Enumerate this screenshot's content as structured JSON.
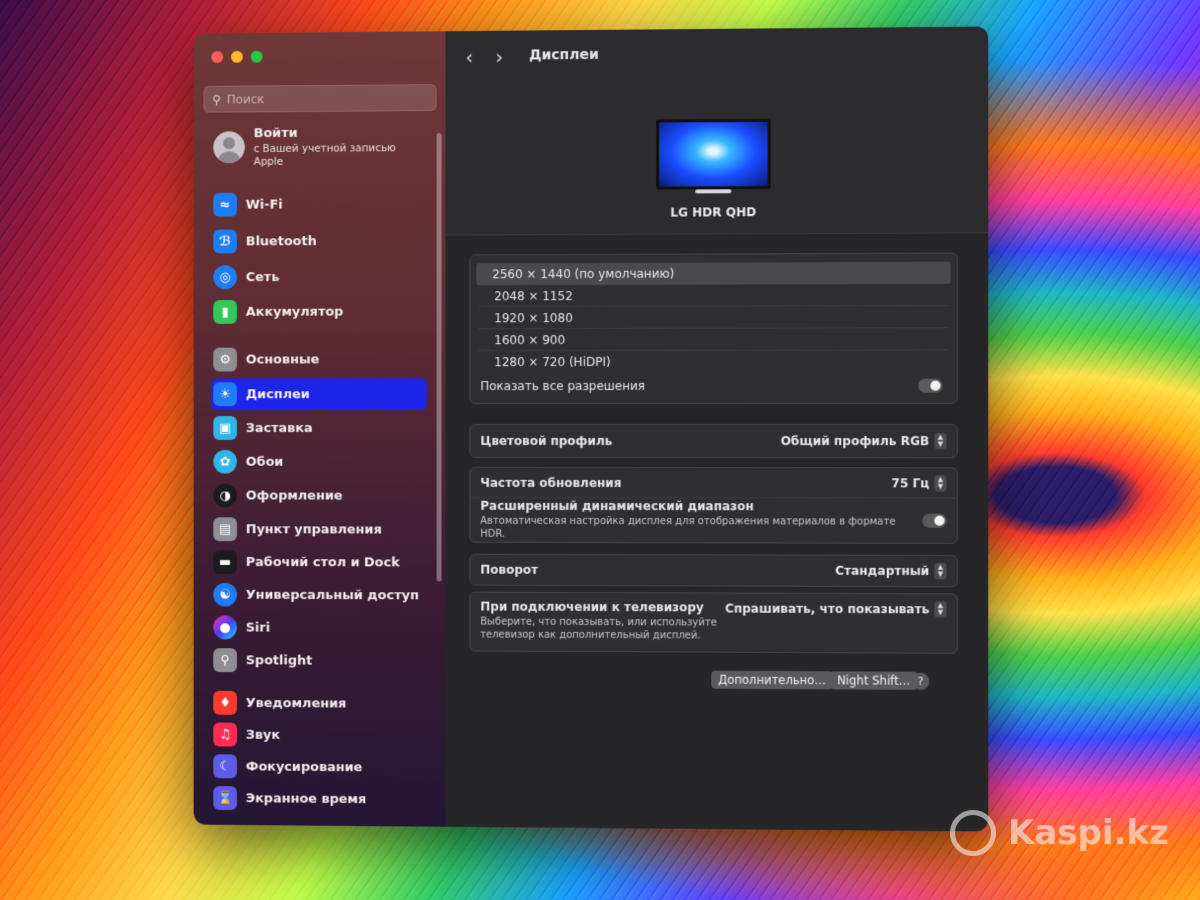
{
  "window": {
    "title": "Дисплеи"
  },
  "sidebar": {
    "search_placeholder": "Поиск",
    "account": {
      "title": "Войти",
      "subtitle": "с Вашей учетной записью Apple"
    },
    "items": [
      {
        "label": "Wi-Fi",
        "icon": "wifi-icon",
        "color": "#1e7cf5"
      },
      {
        "label": "Bluetooth",
        "icon": "bluetooth-icon",
        "color": "#1e7cf5"
      },
      {
        "label": "Сеть",
        "icon": "globe-icon",
        "color": "#1e7cf5"
      },
      {
        "label": "Аккумулятор",
        "icon": "battery-icon",
        "color": "#34c759"
      },
      {
        "label": "Основные",
        "icon": "gear-icon",
        "color": "#8e8e93"
      },
      {
        "label": "Дисплеи",
        "icon": "sun-icon",
        "color": "#1e7cf5",
        "selected": true
      },
      {
        "label": "Заставка",
        "icon": "screensaver-icon",
        "color": "#2fb5e8"
      },
      {
        "label": "Обои",
        "icon": "flower-icon",
        "color": "#2fb5e8"
      },
      {
        "label": "Оформление",
        "icon": "appearance-icon",
        "color": "#1c1c1e"
      },
      {
        "label": "Пункт управления",
        "icon": "control-center-icon",
        "color": "#8e8e93"
      },
      {
        "label": "Рабочий стол и Dock",
        "icon": "dock-icon",
        "color": "#1c1c1e"
      },
      {
        "label": "Универсальный доступ",
        "icon": "accessibility-icon",
        "color": "#1e7cf5"
      },
      {
        "label": "Siri",
        "icon": "siri-icon",
        "color": "#7b3cf0"
      },
      {
        "label": "Spotlight",
        "icon": "magnifier-icon",
        "color": "#8e8e93"
      },
      {
        "label": "Уведомления",
        "icon": "bell-icon",
        "color": "#ff3b30"
      },
      {
        "label": "Звук",
        "icon": "speaker-icon",
        "color": "#ff2d55"
      },
      {
        "label": "Фокусирование",
        "icon": "moon-icon",
        "color": "#5e5ce6"
      },
      {
        "label": "Экранное время",
        "icon": "hourglass-icon",
        "color": "#5e5ce6"
      }
    ]
  },
  "display": {
    "name": "LG HDR QHD",
    "resolutions": [
      "2560 × 1440 (по умолчанию)",
      "2048 × 1152",
      "1920 × 1080",
      "1600 × 900",
      "1280 × 720 (HiDPI)"
    ],
    "selected_resolution": "2560 × 1440 (по умолчанию)",
    "show_all_label": "Показать все разрешения",
    "show_all_on": false,
    "color_profile_label": "Цветовой профиль",
    "color_profile_value": "Общий профиль RGB",
    "refresh_label": "Частота обновления",
    "refresh_value": "75 Гц",
    "hdr_label": "Расширенный динамический диапазон",
    "hdr_desc": "Автоматическая настройка дисплея для отображения материалов в формате HDR.",
    "hdr_on": false,
    "rotation_label": "Поворот",
    "rotation_value": "Стандартный",
    "tv_label": "При подключении к телевизору",
    "tv_desc_1": "Выберите, что показывать, или используйте",
    "tv_desc_2": "телевизор как дополнительный дисплей.",
    "tv_value": "Спрашивать, что показывать",
    "advanced_button": "Дополнительно…",
    "night_shift_button": "Night Shift…",
    "help_button": "?"
  },
  "watermark": "Kaspi.kz"
}
